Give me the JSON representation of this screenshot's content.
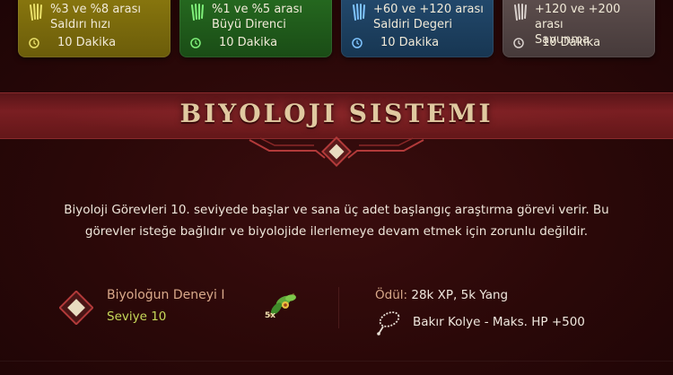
{
  "buff_cards": [
    {
      "icon": "claw-icon",
      "line1": "%3 ve %8 arası",
      "line2": "Saldırı hızı",
      "duration": "10 Dakika",
      "bg": "#7a6a0c",
      "accent": "#e9e06a"
    },
    {
      "icon": "claw-icon",
      "line1": "%1 ve %5 arası",
      "line2": "Büyü Direnci",
      "duration": "10 Dakika",
      "bg": "#1f5a1a",
      "accent": "#7ff07a"
    },
    {
      "icon": "claw-icon",
      "line1": "+60 ve +120 arası",
      "line2": "Saldiri Degeri",
      "duration": "10 Dakika",
      "bg": "#1d3f5e",
      "accent": "#7fc4ff"
    },
    {
      "icon": "claw-icon",
      "line1": "+120 ve +200 arası",
      "line2": "Savunma",
      "duration": "10 Dakika",
      "bg": "#544645",
      "accent": "#d8d0cc"
    }
  ],
  "section": {
    "title": "BIYOLOJI SISTEMI"
  },
  "description": {
    "line1": "Biyoloji Görevleri 10. seviyede başlar ve sana üç adet başlangıç araştırma görevi verir. Bu",
    "line2": "görevler isteğe bağlıdır ve biyolojide ilerlemeye devam etmek için zorunlu değildir."
  },
  "quest": {
    "title": "Biyoloğun Deneyi I",
    "level": "Seviye 10",
    "item_count": "5x",
    "reward_label": "Ödül:",
    "reward_value": "28k XP, 5k Yang",
    "reward_item": "Bakır Kolye - Maks. HP +500"
  }
}
